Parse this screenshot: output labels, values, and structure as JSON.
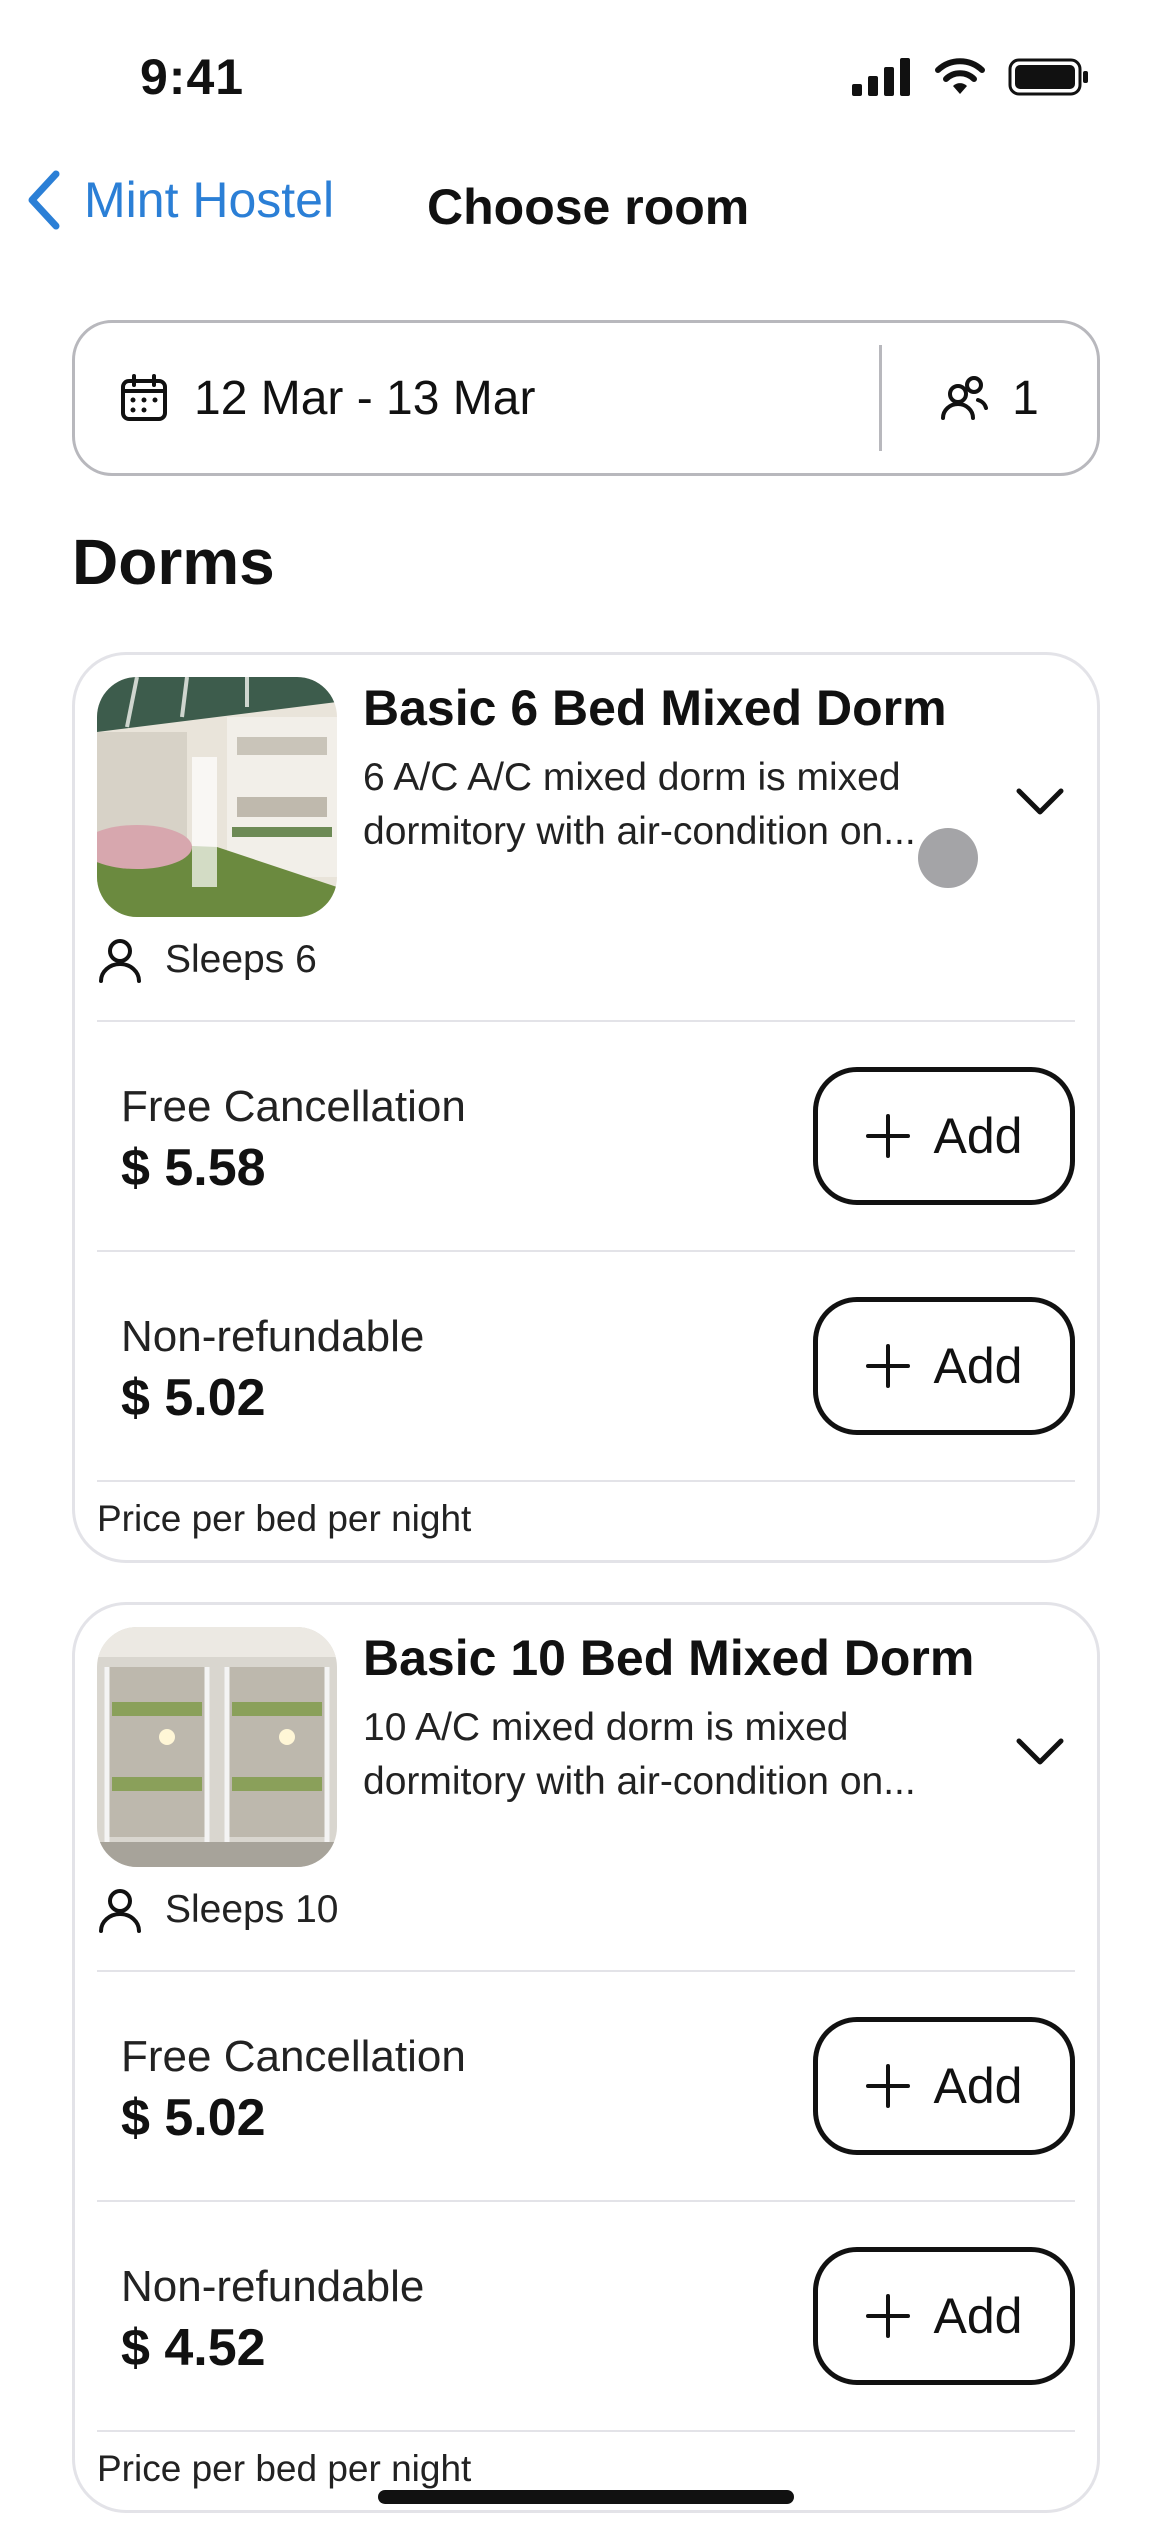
{
  "status_bar": {
    "time": "9:41"
  },
  "nav": {
    "back_label": "Mint Hostel",
    "title": "Choose room"
  },
  "search": {
    "date_range": "12 Mar - 13 Mar",
    "guests": "1"
  },
  "section_title": "Dorms",
  "rooms": [
    {
      "name": "Basic 6 Bed Mixed Dorm",
      "description": "6 A/C A/C mixed dorm is mixed dormitory with air-condition on...",
      "sleeps": "Sleeps 6",
      "rates": [
        {
          "label": "Free Cancellation",
          "price": "$ 5.58",
          "button": "Add"
        },
        {
          "label": "Non-refundable",
          "price": "$ 5.02",
          "button": "Add"
        }
      ],
      "footer": "Price per bed per night"
    },
    {
      "name": "Basic 10 Bed Mixed Dorm",
      "description": "10 A/C mixed dorm is mixed dormitory with air-condition on...",
      "sleeps": "Sleeps 10",
      "rates": [
        {
          "label": "Free Cancellation",
          "price": "$ 5.02",
          "button": "Add"
        },
        {
          "label": "Non-refundable",
          "price": "$ 4.52",
          "button": "Add"
        }
      ],
      "footer": "Price per bed per night"
    }
  ],
  "colors": {
    "accent": "#2b7fd6",
    "border": "#e3e3e8",
    "text": "#111111"
  },
  "icons": [
    "signal-icon",
    "wifi-icon",
    "battery-icon",
    "chevron-left-icon",
    "calendar-icon",
    "guests-icon",
    "person-icon",
    "chevron-down-icon",
    "plus-icon"
  ]
}
